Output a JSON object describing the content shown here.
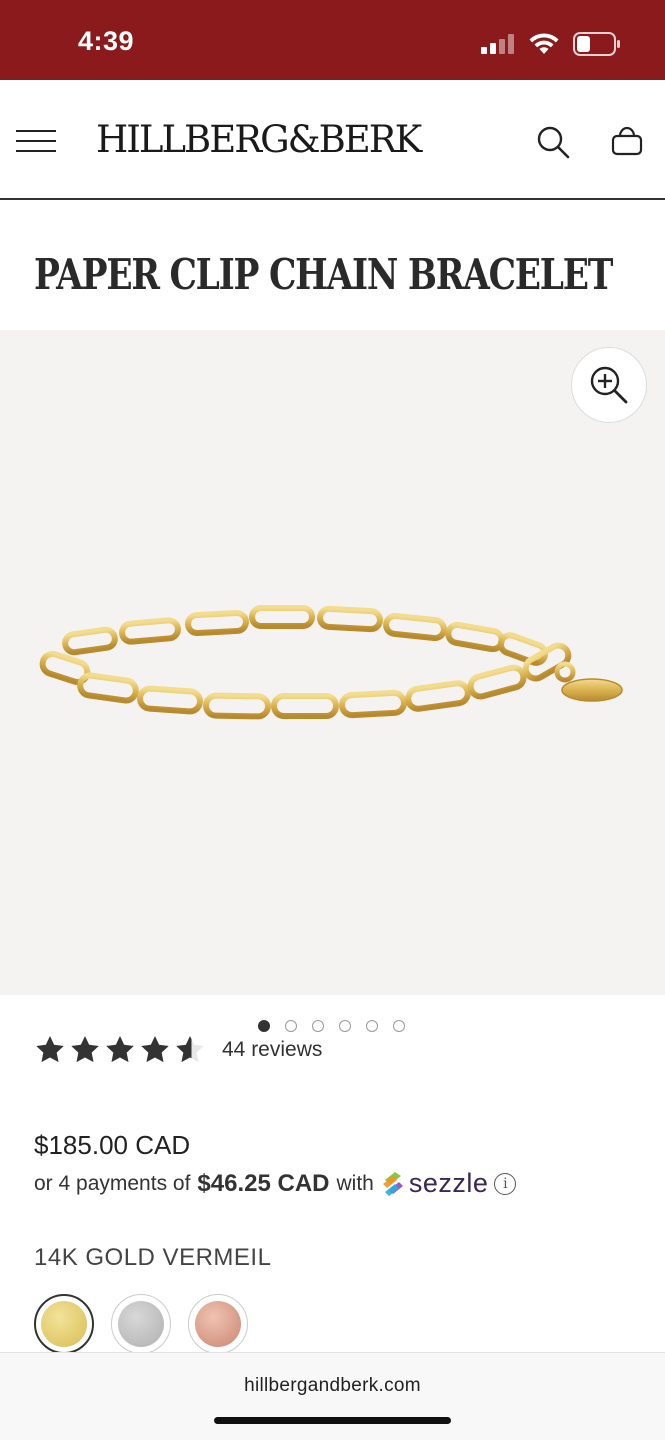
{
  "status_bar": {
    "time": "4:39",
    "background": "#8a1a1c"
  },
  "header": {
    "brand": "HILLBERG&BERK",
    "menu_icon": "hamburger-menu-icon",
    "search_icon": "search-icon",
    "cart_icon": "shopping-bag-icon"
  },
  "product": {
    "title": "PAPER CLIP CHAIN BRACELET",
    "rating": 4.5,
    "reviews": "44 reviews",
    "price": "$185.00 CAD",
    "installments": {
      "prefix": "or 4 payments of",
      "amount": "$46.25 CAD",
      "suffix": "with",
      "provider": "sezzle"
    },
    "metal": "14K GOLD VERMEIL",
    "swatches": [
      {
        "name": "gold",
        "color": "#e6cf73",
        "selected": true
      },
      {
        "name": "silver",
        "color": "#bdbdbd",
        "selected": false
      },
      {
        "name": "rose-gold",
        "color": "#d99a86",
        "selected": false
      }
    ]
  },
  "gallery": {
    "total_images": 6,
    "active_index": 1,
    "background": "#f5f3f1"
  },
  "browser": {
    "url": "hillbergandberk.com"
  }
}
